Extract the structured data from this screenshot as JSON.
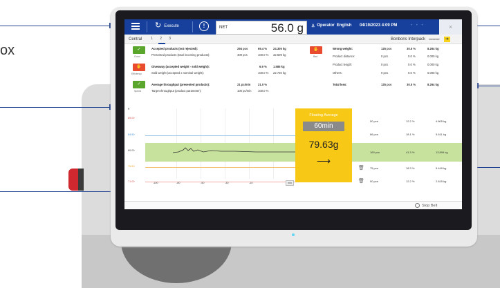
{
  "annotation": {
    "text": "ox"
  },
  "topbar": {
    "execute_label": "Execute",
    "info_label": "!",
    "net_label": "NET",
    "weight_display": "56.0 g",
    "operator_label": "Operator",
    "language": "English",
    "datetime": "04/19/2023 4:09 PM",
    "close_label": "×"
  },
  "tabs": {
    "central_label": "Central",
    "numbers": [
      "1",
      "2",
      "3"
    ],
    "product_name": "Bonbons Interpack",
    "product_small": "########"
  },
  "kpis": [
    {
      "label": "Good",
      "color": "#5aa52b"
    },
    {
      "label": "Efficiency",
      "color": "#e94b2f"
    },
    {
      "label": "Speed",
      "color": "#5aa52b"
    },
    {
      "label": "Bad",
      "color": "#e94b2f"
    }
  ],
  "stats_left": [
    {
      "label": "Accepted products (not rejected):",
      "c1": "294 pcs",
      "c2": "69.4 %",
      "c3": "24.305 kg",
      "bold": true
    },
    {
      "label": "Presented products (total incoming products):",
      "c1": "409 pcs",
      "c2": "100.0 %",
      "c3": "32.509 kg",
      "bold": false
    },
    {
      "label": "Giveaway (accepted weight - sold weight):",
      "c1": "",
      "c2": "6.9 %",
      "c3": "1.585 kg",
      "bold": true
    },
    {
      "label": "Sold weight (accepted x nominal weight):",
      "c1": "",
      "c2": "100.0 %",
      "c3": "22.720 kg",
      "bold": false
    },
    {
      "label": "Average throughput (presented products):",
      "c1": "21 pc/min",
      "c2": "21.0 %",
      "c3": "",
      "bold": true
    },
    {
      "label": "Target throughput (product parameter):",
      "c1": "100 pc/min",
      "c2": "100.0 %",
      "c3": "",
      "bold": false
    }
  ],
  "stats_right": [
    {
      "label": "Wrong weight:",
      "c1": "125 pcs",
      "c2": "30.5 %",
      "c3": "8.264 kg",
      "bold": true
    },
    {
      "label": "Product distance:",
      "c1": "0 pcs",
      "c2": "0.0 %",
      "c3": "0.000 kg",
      "bold": false
    },
    {
      "label": "Product length:",
      "c1": "0 pcs",
      "c2": "0.0 %",
      "c3": "0.000 kg",
      "bold": false
    },
    {
      "label": "Others:",
      "c1": "0 pcs",
      "c2": "0.0 %",
      "c3": "0.000 kg",
      "bold": false
    },
    {
      "label": "Total loss:",
      "c1": "125 pcs",
      "c2": "30.5 %",
      "c3": "8.264 kg",
      "bold": true
    }
  ],
  "chart": {
    "y_labels": [
      {
        "text": "89.00",
        "color": "#d9534f"
      },
      {
        "text": "84.50",
        "color": "#3b8fd9"
      },
      {
        "text": "80.00",
        "color": "#444444"
      },
      {
        "text": "75.50",
        "color": "#f5a623"
      },
      {
        "text": "71.00",
        "color": "#d9534f"
      }
    ],
    "x_labels": [
      "-100",
      "-80",
      "-50",
      "-30",
      "-10"
    ],
    "x_unit": "min"
  },
  "floating_average": {
    "title": "Floating Average",
    "period": "60min",
    "value": "79.63g",
    "trend_arrow": "⟶"
  },
  "distribution": [
    {
      "c1": "50 pcs",
      "c2": "12.2 %",
      "c3": "4.805 kg",
      "highlight": false,
      "bin": false
    },
    {
      "c1": "86 pcs",
      "c2": "18.1 %",
      "c3": "5.611 kg",
      "highlight": false,
      "bin": false
    },
    {
      "c1": "169 pcs",
      "c2": "41.3 %",
      "c3": "13.899 kg",
      "highlight": true,
      "bin": false
    },
    {
      "c1": "75 pcs",
      "c2": "18.3 %",
      "c3": "5.449 kg",
      "highlight": false,
      "bin": true
    },
    {
      "c1": "50 pcs",
      "c2": "12.2 %",
      "c3": "2.815 kg",
      "highlight": false,
      "bin": true
    }
  ],
  "bottom": {
    "stop_belt_label": "Stop Belt"
  },
  "colors": {
    "brand": "#16409b",
    "accent_yellow": "#f8c817",
    "band_green": "#c6e29c"
  }
}
